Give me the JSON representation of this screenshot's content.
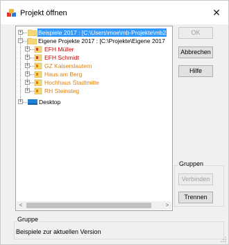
{
  "window": {
    "title": "Projekt öffnen",
    "close_glyph": "✕"
  },
  "tree": {
    "items": [
      {
        "label": "Beispiele 2017 : [C:\\Users\\moe\\mb-Projekte\\mb2",
        "selected": true,
        "color": "#ffffff"
      },
      {
        "label": "Eigene Projekte 2017 : [C:\\Projekte\\Eigene 2017",
        "color": "#000000"
      },
      {
        "label": "EFH Müller",
        "color": "#cc0000"
      },
      {
        "label": "EFH Schmidt",
        "color": "#cc0000"
      },
      {
        "label": "GZ Kaiserslautern",
        "color": "#e67e00"
      },
      {
        "label": "Haus am Berg",
        "color": "#e67e00"
      },
      {
        "label": "Hochhaus Stadtmitte",
        "color": "#e67e00"
      },
      {
        "label": "RH Steinsteg",
        "color": "#e67e00"
      },
      {
        "label": "Desktop",
        "color": "#000000"
      }
    ],
    "scroll_left": "<",
    "scroll_right": ">"
  },
  "buttons": {
    "ok": "OK",
    "cancel": "Abbrechen",
    "help": "Hilfe",
    "connect": "Verbinden",
    "separate": "Trennen"
  },
  "groups": {
    "right_legend": "Gruppen",
    "bottom_legend": "Gruppe",
    "bottom_text": "Beispiele zur aktuellen Version"
  },
  "colors": {
    "selection": "#3399ff",
    "project_red": "#cc0000",
    "project_orange": "#e67e00"
  }
}
